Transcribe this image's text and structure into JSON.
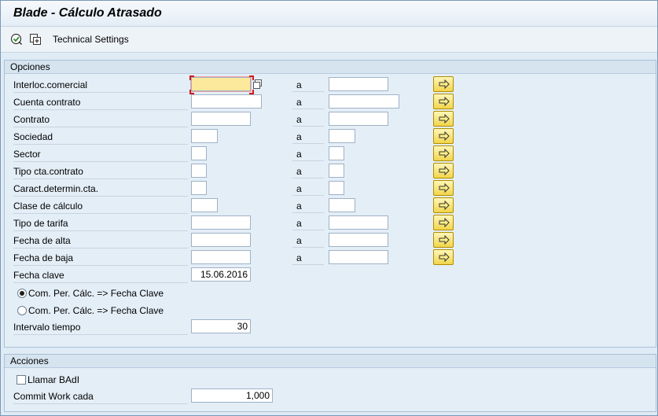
{
  "window": {
    "title": "Blade - Cálculo Atrasado"
  },
  "toolbar": {
    "execute_icon": "execute-icon",
    "variant_icon": "get-variant-icon",
    "technical_settings_label": "Technical Settings"
  },
  "options": {
    "title": "Opciones",
    "to_label": "a",
    "rows": [
      {
        "label": "Interloc.comercial",
        "from": "",
        "to": ""
      },
      {
        "label": "Cuenta contrato",
        "from": "",
        "to": ""
      },
      {
        "label": "Contrato",
        "from": "",
        "to": ""
      },
      {
        "label": "Sociedad",
        "from": "",
        "to": ""
      },
      {
        "label": "Sector",
        "from": "",
        "to": ""
      },
      {
        "label": "Tipo cta.contrato",
        "from": "",
        "to": ""
      },
      {
        "label": "Caract.determin.cta.",
        "from": "",
        "to": ""
      },
      {
        "label": "Clase de cálculo",
        "from": "",
        "to": ""
      },
      {
        "label": "Tipo de tarifa",
        "from": "",
        "to": ""
      },
      {
        "label": "Fecha de alta",
        "from": "",
        "to": ""
      },
      {
        "label": "Fecha de baja",
        "from": "",
        "to": ""
      }
    ],
    "key_date": {
      "label": "Fecha clave",
      "value": "15.06.2016"
    },
    "radio_1": {
      "label": "Com. Per. Cálc. => Fecha Clave",
      "selected": true
    },
    "radio_2": {
      "label": "Com. Per. Cálc. => Fecha Clave",
      "selected": false
    },
    "interval": {
      "label": "Intervalo tiempo",
      "value": "30"
    }
  },
  "actions": {
    "title": "Acciones",
    "badi": {
      "label": "Llamar BAdI",
      "checked": false
    },
    "commit": {
      "label": "Commit Work cada",
      "value": "1,000"
    }
  },
  "colors": {
    "background": "#dfebf5",
    "focus_field": "#fde99b",
    "multi_select_button": "#f2d54a"
  }
}
